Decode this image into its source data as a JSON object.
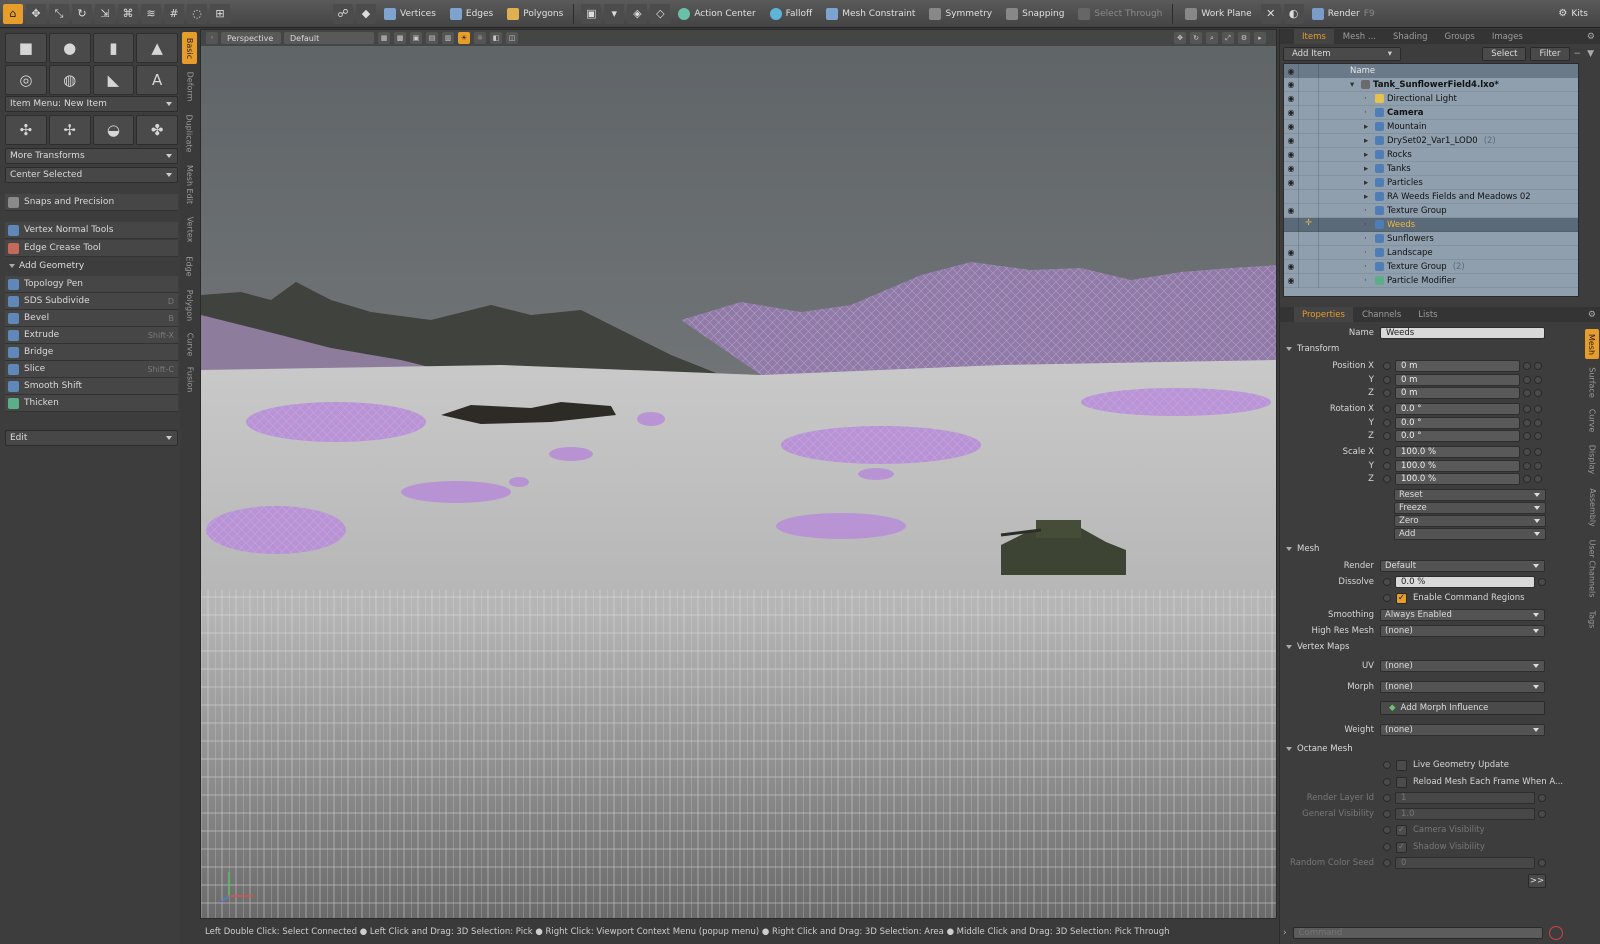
{
  "toolbar": {
    "vertices": "Vertices",
    "edges": "Edges",
    "polygons": "Polygons",
    "action_center": "Action Center",
    "falloff": "Falloff",
    "mesh_constraint": "Mesh Constraint",
    "symmetry": "Symmetry",
    "snapping": "Snapping",
    "select_through": "Select Through",
    "work_plane": "Work Plane",
    "render": "Render",
    "render_key": "F9",
    "kits": "Kits"
  },
  "left_panel": {
    "item_menu": "Item Menu: New Item",
    "more_transforms": "More Transforms",
    "center_selected": "Center Selected",
    "snaps": "Snaps and Precision",
    "vertex_normal": "Vertex Normal Tools",
    "edge_crease": "Edge Crease Tool",
    "add_geometry": "Add Geometry",
    "tools": [
      {
        "label": "Topology Pen",
        "key": ""
      },
      {
        "label": "SDS Subdivide",
        "key": "D"
      },
      {
        "label": "Bevel",
        "key": "B"
      },
      {
        "label": "Extrude",
        "key": "Shift-X"
      },
      {
        "label": "Bridge",
        "key": ""
      },
      {
        "label": "Slice",
        "key": "Shift-C"
      },
      {
        "label": "Smooth Shift",
        "key": ""
      },
      {
        "label": "Thicken",
        "key": ""
      }
    ],
    "edit": "Edit"
  },
  "vtabs": [
    "Basic",
    "Deform",
    "Duplicate",
    "Mesh Edit",
    "Vertex",
    "Edge",
    "Polygon",
    "Curve",
    "Fusion"
  ],
  "viewport": {
    "view": "Perspective",
    "style": "Default"
  },
  "statusbar": "Left Double Click: Select Connected ●  Left Click and Drag: 3D Selection: Pick ●  Right Click: Viewport Context Menu (popup menu) ●  Right Click and Drag: 3D Selection: Area ●  Middle Click and Drag: 3D Selection: Pick Through",
  "items_panel": {
    "tabs": [
      "Items",
      "Mesh ...",
      "Shading",
      "Groups",
      "Images"
    ],
    "add_item": "Add Item",
    "select": "Select",
    "filter": "Filter",
    "name_header": "Name",
    "rows": [
      {
        "name": "Tank_SunflowerField4.lxo*",
        "count": "",
        "eye": true
      },
      {
        "name": "Directional Light",
        "count": "",
        "eye": true
      },
      {
        "name": "Camera",
        "count": "",
        "eye": true
      },
      {
        "name": "Mountain",
        "count": "",
        "eye": true
      },
      {
        "name": "DrySet02_Var1_LOD0",
        "count": "(2)",
        "eye": true
      },
      {
        "name": "Rocks",
        "count": "",
        "eye": true
      },
      {
        "name": "Tanks",
        "count": "",
        "eye": true
      },
      {
        "name": "Particles",
        "count": "",
        "eye": true
      },
      {
        "name": "RA Weeds Fields and Meadows 02",
        "count": "",
        "eye": false
      },
      {
        "name": "Texture Group",
        "count": "",
        "eye": true
      },
      {
        "name": "Weeds",
        "count": "",
        "eye": false
      },
      {
        "name": "Sunflowers",
        "count": "",
        "eye": false
      },
      {
        "name": "Landscape",
        "count": "",
        "eye": true
      },
      {
        "name": "Texture Group",
        "count": "(2)",
        "eye": true
      },
      {
        "name": "Particle Modifier",
        "count": "",
        "eye": true
      }
    ]
  },
  "properties": {
    "tabs": [
      "Properties",
      "Channels",
      "Lists"
    ],
    "name_label": "Name",
    "name_value": "Weeds",
    "transform": "Transform",
    "position_label": "Position X",
    "rotation_label": "Rotation X",
    "scale_label": "Scale X",
    "y": "Y",
    "z": "Z",
    "position": [
      "0 m",
      "0 m",
      "0 m"
    ],
    "rotation": [
      "0.0 °",
      "0.0 °",
      "0.0 °"
    ],
    "scale": [
      "100.0 %",
      "100.0 %",
      "100.0 %"
    ],
    "actions": [
      "Reset",
      "Freeze",
      "Zero",
      "Add"
    ],
    "mesh": "Mesh",
    "render_label": "Render",
    "render_value": "Default",
    "dissolve_label": "Dissolve",
    "dissolve_value": "0.0 %",
    "enable_cmd": "Enable Command Regions",
    "smoothing_label": "Smoothing",
    "smoothing_value": "Always Enabled",
    "highres_label": "High Res Mesh",
    "highres_value": "(none)",
    "vertex_maps": "Vertex Maps",
    "uv_label": "UV",
    "uv_value": "(none)",
    "morph_label": "Morph",
    "morph_value": "(none)",
    "add_morph": "Add Morph Influence",
    "weight_label": "Weight",
    "weight_value": "(none)",
    "octane": "Octane Mesh",
    "live_geo": "Live Geometry Update",
    "reload": "Reload Mesh Each Frame When A...",
    "render_layer_label": "Render Layer Id",
    "render_layer_value": "1",
    "gen_vis_label": "General Visibility",
    "gen_vis_value": "1.0",
    "cam_vis": "Camera Visibility",
    "shadow_vis": "Shadow Visibility",
    "seed_label": "Random Color Seed",
    "seed_value": "0",
    "more": ">>"
  },
  "rvtabs": [
    "Mesh",
    "Surface",
    "Curve",
    "Display",
    "Assembly",
    "User Channels",
    "Tags"
  ],
  "command": {
    "placeholder": "Command"
  }
}
